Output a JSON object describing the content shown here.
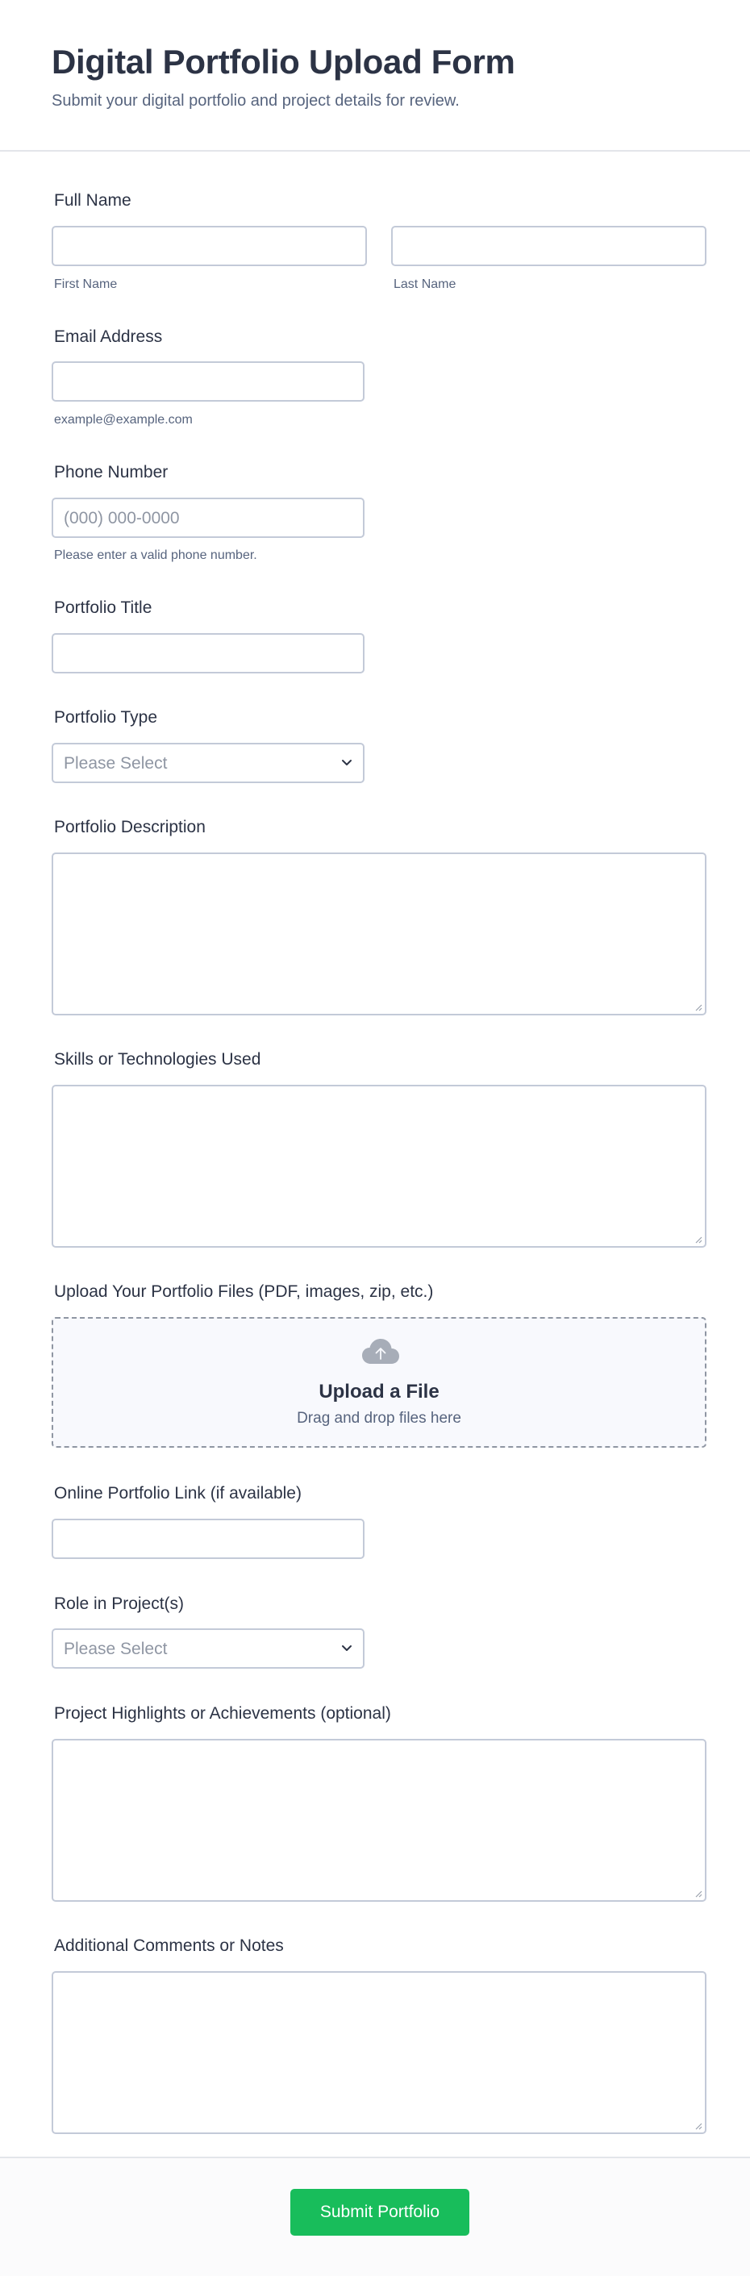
{
  "header": {
    "title": "Digital Portfolio Upload Form",
    "subtitle": "Submit your digital portfolio and project details for review."
  },
  "fields": {
    "full_name": {
      "label": "Full Name",
      "first_sublabel": "First Name",
      "last_sublabel": "Last Name",
      "first_value": "",
      "last_value": ""
    },
    "email": {
      "label": "Email Address",
      "sublabel": "example@example.com",
      "value": ""
    },
    "phone": {
      "label": "Phone Number",
      "placeholder": "(000) 000-0000",
      "sublabel": "Please enter a valid phone number."
    },
    "portfolio_title": {
      "label": "Portfolio Title",
      "value": ""
    },
    "portfolio_type": {
      "label": "Portfolio Type",
      "selected": "Please Select",
      "icon": "chevron-down-icon"
    },
    "portfolio_description": {
      "label": "Portfolio Description",
      "value": ""
    },
    "skills": {
      "label": "Skills or Technologies Used",
      "value": ""
    },
    "upload": {
      "label": "Upload Your Portfolio Files (PDF, images, zip, etc.)",
      "title": "Upload a File",
      "hint": "Drag and drop files here",
      "icon": "cloud-upload-icon"
    },
    "online_link": {
      "label": "Online Portfolio Link (if available)",
      "value": ""
    },
    "role": {
      "label": "Role in Project(s)",
      "selected": "Please Select",
      "icon": "chevron-down-icon"
    },
    "highlights": {
      "label": "Project Highlights or Achievements (optional)",
      "value": ""
    },
    "comments": {
      "label": "Additional Comments or Notes",
      "value": ""
    }
  },
  "footer": {
    "submit_label": "Submit Portfolio"
  },
  "colors": {
    "accent": "#18bd5b",
    "text": "#2c3345",
    "muted": "#57647e",
    "border": "#c3cad8",
    "upload_bg": "#f8f9fd"
  }
}
